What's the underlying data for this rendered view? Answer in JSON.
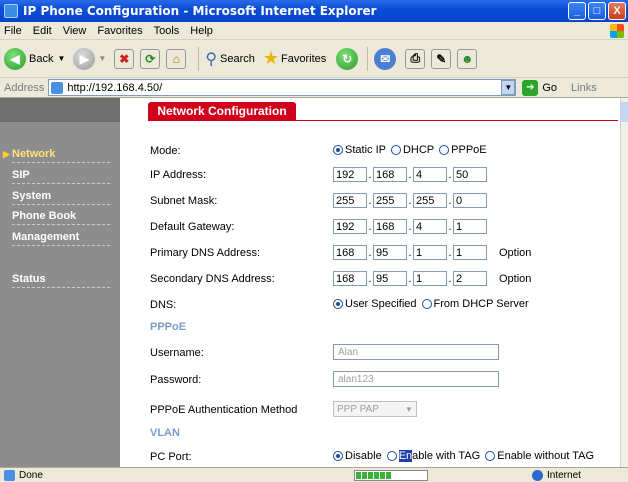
{
  "window": {
    "title": "IP Phone Configuration - Microsoft Internet Explorer",
    "min": "_",
    "max": "□",
    "close": "X"
  },
  "menu": [
    "File",
    "Edit",
    "View",
    "Favorites",
    "Tools",
    "Help"
  ],
  "toolbar": {
    "back": "Back",
    "search": "Search",
    "favorites": "Favorites"
  },
  "address": {
    "label": "Address",
    "url": "http://192.168.4.50/",
    "go": "Go",
    "links": "Links"
  },
  "sidebar": {
    "network": "Network",
    "sip": "SIP",
    "system": "System",
    "phonebook": "Phone Book",
    "management": "Management",
    "status": "Status"
  },
  "tab": {
    "label": "Network Configuration"
  },
  "form": {
    "mode": {
      "label": "Mode:",
      "options": [
        "Static IP",
        "DHCP",
        "PPPoE"
      ],
      "selected": "Static IP"
    },
    "ip_address": {
      "label": "IP Address:",
      "octets": [
        "192",
        "168",
        "4",
        "50"
      ]
    },
    "subnet_mask": {
      "label": "Subnet Mask:",
      "octets": [
        "255",
        "255",
        "255",
        "0"
      ]
    },
    "gateway": {
      "label": "Default Gateway:",
      "octets": [
        "192",
        "168",
        "4",
        "1"
      ]
    },
    "primary_dns": {
      "label": "Primary DNS Address:",
      "octets": [
        "168",
        "95",
        "1",
        "1"
      ],
      "suffix": "Option"
    },
    "secondary_dns": {
      "label": "Secondary DNS Address:",
      "octets": [
        "168",
        "95",
        "1",
        "2"
      ],
      "suffix": "Option"
    },
    "dns": {
      "label": "DNS:",
      "options": [
        "User Specified",
        "From DHCP Server"
      ],
      "selected": "User Specified"
    },
    "pppoe_section": "PPPoE",
    "username": {
      "label": "Username:",
      "value": "Alan"
    },
    "password": {
      "label": "Password:",
      "value": "alan123"
    },
    "auth": {
      "label": "PPPoE Authentication Method",
      "value": "PPP PAP"
    },
    "vlan_section": "VLAN",
    "pc_port": {
      "label": "PC Port:",
      "options": [
        "Disable",
        "Enable with TAG",
        "Enable without TAG"
      ],
      "selected": "Disable",
      "enable_hl": "En",
      "enable_rest": "able with TAG"
    }
  },
  "status": {
    "text": "Done",
    "zone": "Internet",
    "progress_fraction": 0.5
  },
  "colors": {
    "accent": "#d0021b",
    "sidebar": "#8d8d8d",
    "section": "#7c9bc4"
  }
}
